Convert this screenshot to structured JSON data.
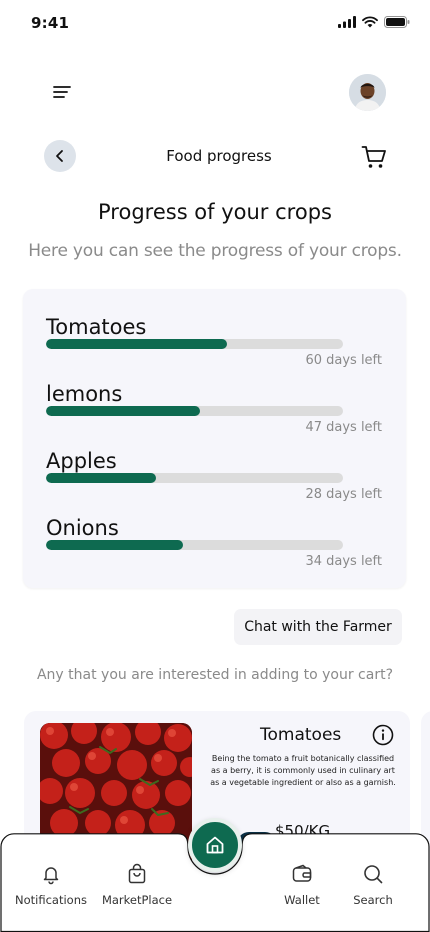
{
  "status_bar": {
    "time": "9:41"
  },
  "header": {
    "title": "Food progress"
  },
  "main": {
    "heading": "Progress of your crops",
    "subheading": "Here you can see the progress of your crops.",
    "crops": [
      {
        "name": "Tomatoes",
        "progress": 0.61,
        "days_left": "60 days left"
      },
      {
        "name": "lemons",
        "progress": 0.52,
        "days_left": "47 days left"
      },
      {
        "name": "Apples",
        "progress": 0.37,
        "days_left": "28 days left"
      },
      {
        "name": "Onions",
        "progress": 0.46,
        "days_left": "34 days left"
      }
    ],
    "chat_button_label": "Chat with the Farmer",
    "interest_text": "Any that you are interested in adding to your cart?",
    "product": {
      "name": "Tomatoes",
      "description": "Being the tomato a fruit botanically classified as a berry, it is commonly used in culinary art as a vegetable ingredient or also as a garnish.",
      "price": "$50/KG"
    }
  },
  "bottom_nav": {
    "items": [
      {
        "label": "Notifications",
        "icon": "bell-icon"
      },
      {
        "label": "MarketPlace",
        "icon": "shopping-bag-icon"
      },
      {
        "label": "Wallet",
        "icon": "wallet-icon"
      },
      {
        "label": "Search",
        "icon": "search-icon"
      }
    ],
    "home_icon": "home-icon"
  },
  "colors": {
    "accent": "#0e6a50",
    "track": "#dcdcdc",
    "card_bg": "#f6f6fb",
    "muted_text": "#8a8a8a"
  }
}
